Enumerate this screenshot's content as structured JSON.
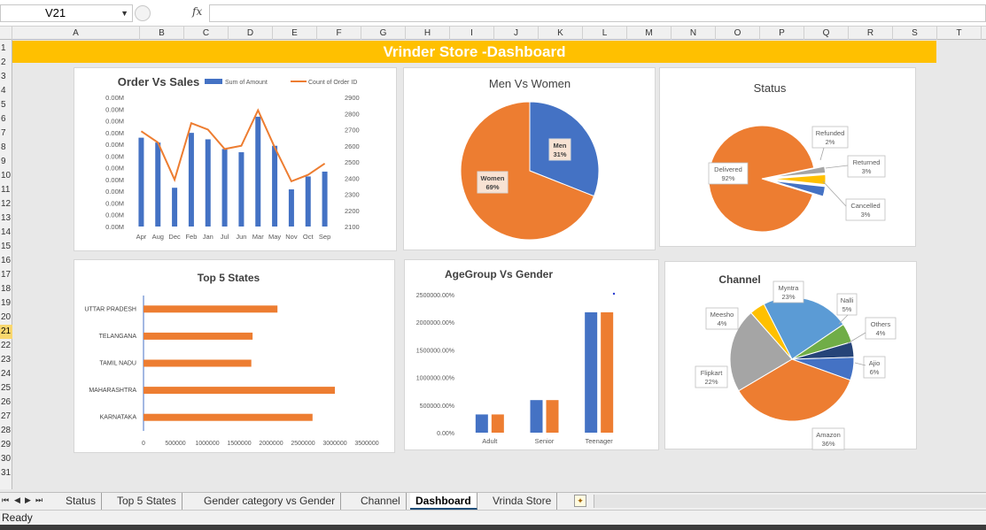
{
  "formula_bar": {
    "name_box": "V21",
    "fx_label": "fx",
    "formula": ""
  },
  "columns": [
    "A",
    "B",
    "C",
    "D",
    "E",
    "F",
    "G",
    "H",
    "I",
    "J",
    "K",
    "L",
    "M",
    "N",
    "O",
    "P",
    "Q",
    "R",
    "S",
    "T"
  ],
  "rows": [
    "1",
    "2",
    "3",
    "4",
    "5",
    "6",
    "7",
    "8",
    "9",
    "10",
    "11",
    "12",
    "13",
    "14",
    "15",
    "16",
    "17",
    "18",
    "19",
    "20",
    "21",
    "22",
    "23",
    "24",
    "25",
    "26",
    "27",
    "28",
    "29",
    "30",
    "31"
  ],
  "selected_row": "21",
  "dashboard_title": "Vrinder Store -Dashboard",
  "colors": {
    "blue": "#4472c4",
    "orange": "#ed7d31",
    "banner": "#ffc000",
    "gray": "#a5a5a5",
    "yellow": "#ffc000",
    "lightblue": "#5b9bd5",
    "green": "#70ad47",
    "navy": "#264478"
  },
  "chart_data": [
    {
      "id": "order_vs_sales",
      "type": "bar",
      "title": "Order Vs Sales",
      "categories": [
        "Apr",
        "Aug",
        "Dec",
        "Feb",
        "Jan",
        "Jul",
        "Jun",
        "Mar",
        "May",
        "Nov",
        "Oct",
        "Sep"
      ],
      "series": [
        {
          "name": "Sum of Amount",
          "type": "bar",
          "axis": "left",
          "values": [
            2650,
            2620,
            2340,
            2680,
            2640,
            2580,
            2560,
            2780,
            2600,
            2330,
            2410,
            2440
          ]
        },
        {
          "name": "Count of Order ID",
          "type": "line",
          "axis": "right",
          "values": [
            2690,
            2620,
            2390,
            2740,
            2700,
            2580,
            2600,
            2820,
            2590,
            2380,
            2420,
            2490
          ]
        }
      ],
      "left_axis_ticks": [
        "0.00M",
        "0.00M",
        "0.00M",
        "0.00M",
        "0.00M",
        "0.00M",
        "0.00M",
        "0.00M",
        "0.00M",
        "0.00M",
        "0.00M",
        "0.00M"
      ],
      "right_axis_ticks": [
        "2900",
        "2800",
        "2700",
        "2600",
        "2500",
        "2400",
        "2300",
        "2200",
        "2100"
      ],
      "ylim": [
        2100,
        2900
      ]
    },
    {
      "id": "men_vs_women",
      "type": "pie",
      "title": "Men Vs Women",
      "slices": [
        {
          "label": "Men",
          "pct_label": "31%",
          "value": 31
        },
        {
          "label": "Women",
          "pct_label": "69%",
          "value": 69
        }
      ]
    },
    {
      "id": "status",
      "type": "pie",
      "title": "Status",
      "slices": [
        {
          "label": "Delivered",
          "pct_label": "92%",
          "value": 92
        },
        {
          "label": "Refunded",
          "pct_label": "2%",
          "value": 2
        },
        {
          "label": "Returned",
          "pct_label": "3%",
          "value": 3
        },
        {
          "label": "Cancelled",
          "pct_label": "3%",
          "value": 3
        }
      ]
    },
    {
      "id": "top5_states",
      "type": "bar",
      "orientation": "horizontal",
      "title": "Top 5 States",
      "categories": [
        "UTTAR PRADESH",
        "TELANGANA",
        "TAMIL NADU",
        "MAHARASHTRA",
        "KARNATAKA"
      ],
      "values": [
        2100000,
        1710000,
        1690000,
        3000000,
        2650000
      ],
      "x_ticks": [
        "0",
        "500000",
        "1000000",
        "1500000",
        "2000000",
        "2500000",
        "3000000",
        "3500000"
      ],
      "xlim": [
        0,
        3500000
      ]
    },
    {
      "id": "agegroup_vs_gender",
      "type": "bar",
      "title": "AgeGroup Vs Gender",
      "categories": [
        "Adult",
        "Senior",
        "Teenager"
      ],
      "series": [
        {
          "values": [
            330000,
            590000,
            2180000
          ]
        },
        {
          "values": [
            330000,
            590000,
            2180000
          ]
        }
      ],
      "y_ticks": [
        "2500000.00%",
        "2000000.00%",
        "1500000.00%",
        "1000000.00%",
        "500000.00%",
        "0.00%"
      ],
      "ylim": [
        0,
        2500000
      ]
    },
    {
      "id": "channel",
      "type": "pie",
      "title": "Channel",
      "slices": [
        {
          "label": "Myntra",
          "pct_label": "23%",
          "value": 23
        },
        {
          "label": "Nalli",
          "pct_label": "5%",
          "value": 5
        },
        {
          "label": "Others",
          "pct_label": "4%",
          "value": 4
        },
        {
          "label": "Ajio",
          "pct_label": "6%",
          "value": 6
        },
        {
          "label": "Amazon",
          "pct_label": "36%",
          "value": 36
        },
        {
          "label": "Flipkart",
          "pct_label": "22%",
          "value": 22
        },
        {
          "label": "Meesho",
          "pct_label": "4%",
          "value": 4
        }
      ]
    }
  ],
  "sheet_tabs": [
    "Status",
    "Top 5 States",
    "Gender category vs Gender",
    "Channel",
    "Dashboard",
    "Vrinda Store"
  ],
  "active_tab": "Dashboard",
  "status_text": "Ready"
}
